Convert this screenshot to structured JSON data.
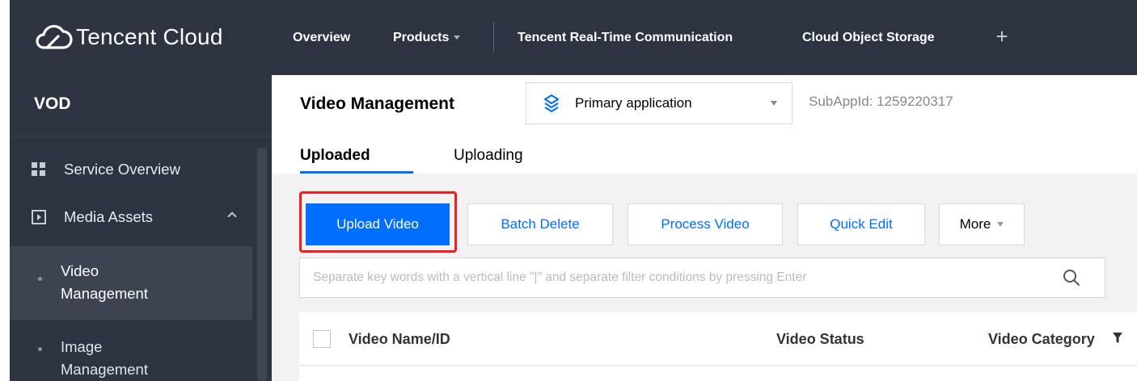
{
  "topbar": {
    "brand": "Tencent Cloud",
    "nav": [
      "Overview",
      "Products",
      "Tencent Real-Time Communication",
      "Cloud Object Storage"
    ]
  },
  "sidebar": {
    "title": "VOD",
    "items": [
      {
        "label": "Service Overview",
        "icon": "grid-icon"
      },
      {
        "label": "Media Assets",
        "icon": "media-assets-icon"
      }
    ],
    "subitems": [
      {
        "line1": "Video",
        "line2": "Management"
      },
      {
        "line1": "Image",
        "line2": "Management"
      }
    ]
  },
  "main": {
    "title": "Video Management",
    "app_select": "Primary application",
    "subappid": "SubAppId: 1259220317",
    "tabs": [
      "Uploaded",
      "Uploading"
    ],
    "buttons": {
      "upload": "Upload Video",
      "batch_delete": "Batch Delete",
      "process": "Process Video",
      "quick_edit": "Quick Edit",
      "more": "More"
    },
    "search_placeholder": "Separate key words with a vertical line \"|\" and separate filter conditions by pressing Enter",
    "table": {
      "headers": [
        "Video Name/ID",
        "Video Status",
        "Video Category"
      ]
    }
  },
  "colors": {
    "topbar_bg": "#2d3341",
    "accent": "#006eff",
    "highlight": "#f01e1e"
  }
}
